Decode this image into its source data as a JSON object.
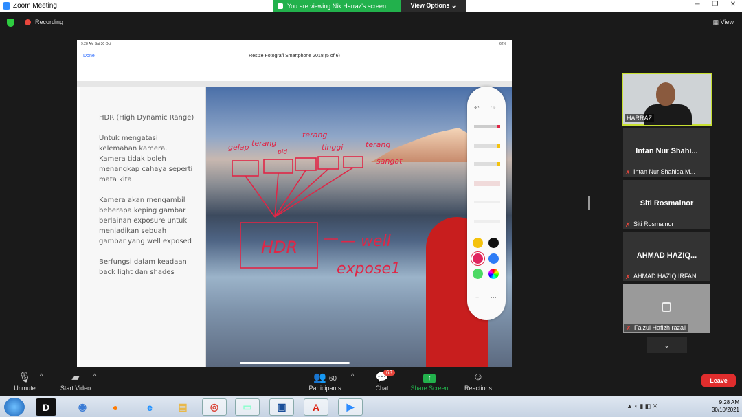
{
  "window": {
    "title": "Zoom Meeting",
    "controls": [
      "─",
      "❐",
      "✕"
    ]
  },
  "banner": {
    "text": "You are viewing Nik Harraz's screen",
    "view_options": "View Options ⌄"
  },
  "toprow": {
    "recording": "Recording",
    "view": "View"
  },
  "shared_screen": {
    "status_time": "9:28 AM  Sat 30 Oct",
    "battery": "62%",
    "done": "Done",
    "doc_title": "Resize Fotografi Smartphone 2018 (5 of 6)",
    "slide_text": [
      "HDR (High Dynamic Range)",
      "Untuk mengatasi kelemahan kamera. Kamera tidak boleh menangkap cahaya seperti mata kita",
      "Kamera akan mengambil beberapa keping gambar berlainan exposure untuk menjadikan sebuah gambar yang well exposed",
      "Berfungsi dalam keadaan back light dan shades"
    ],
    "annotations": {
      "words": [
        "gelap",
        "terang",
        "pld",
        "terang",
        "tinggi",
        "terang",
        "sangat"
      ],
      "hdr": "HDR",
      "result": "— well",
      "result2": "expose1"
    },
    "palette_colors": [
      "#f4c20d",
      "#111111",
      "#e0245e",
      "#2d7cf6",
      "#4cd964",
      "#c9a0ff"
    ]
  },
  "participants": [
    {
      "label": "HARRAZ"
    },
    {
      "name": "Intan Nur Shahi...",
      "sub": "Intan Nur Shahida M..."
    },
    {
      "name": "Siti Rosmainor",
      "sub": "Siti Rosmainor"
    },
    {
      "name": "AHMAD  HAZIQ...",
      "sub": "AHMAD HAZIQ IRFAN..."
    },
    {
      "name": "",
      "sub": "Faizul Hafizh razali"
    }
  ],
  "toolbar": {
    "unmute": "Unmute",
    "start_video": "Start Video",
    "participants": "Participants",
    "participants_count": "60",
    "chat": "Chat",
    "chat_badge": "63",
    "share_screen": "Share Screen",
    "reactions": "Reactions",
    "leave": "Leave"
  },
  "taskbar": {
    "time": "9:28 AM",
    "date": "30/10/2021"
  }
}
